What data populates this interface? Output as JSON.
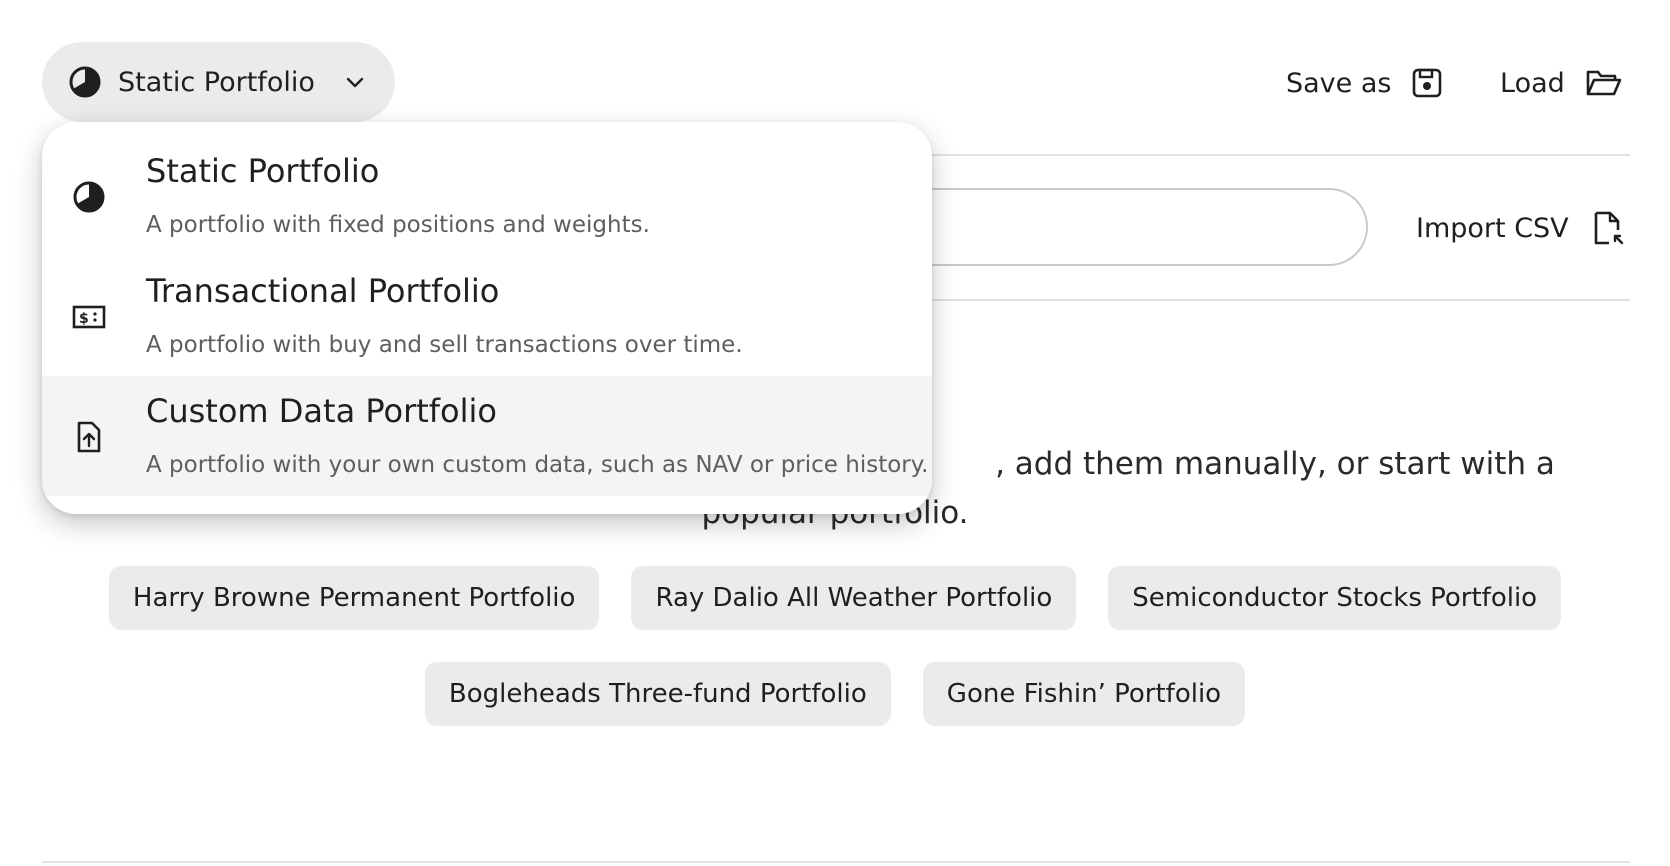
{
  "portfolio_type_selector": {
    "selected_label": "Static Portfolio",
    "icon": "pie-chart-icon"
  },
  "toolbar": {
    "save_as_label": "Save as",
    "save_icon": "floppy-disk-icon",
    "load_label": "Load",
    "load_icon": "open-folder-icon"
  },
  "import": {
    "label": "Import CSV",
    "icon": "file-import-icon"
  },
  "empty_state": {
    "visible_text": ", add them manually, or start with a popular portfolio."
  },
  "presets": [
    "Harry Browne Permanent Portfolio",
    "Ray Dalio All Weather Portfolio",
    "Semiconductor Stocks Portfolio",
    "Bogleheads Three-fund Portfolio",
    "Gone Fishin’ Portfolio"
  ],
  "menu": {
    "items": [
      {
        "title": "Static Portfolio",
        "description": "A portfolio with fixed positions and weights.",
        "icon": "pie-chart-icon"
      },
      {
        "title": "Transactional Portfolio",
        "description": "A portfolio with buy and sell transactions over time.",
        "icon": "cash-transaction-icon"
      },
      {
        "title": "Custom Data Portfolio",
        "description": "A portfolio with your own custom data, such as NAV or price history.",
        "icon": "file-upload-icon"
      }
    ],
    "highlighted_index": 2
  }
}
